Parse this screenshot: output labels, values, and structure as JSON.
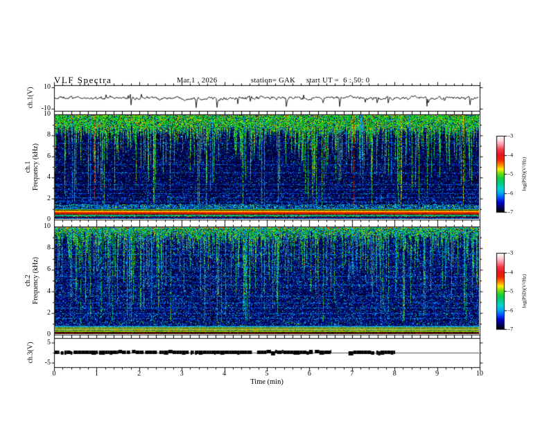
{
  "header": {
    "title": "VLF Spectra",
    "date": "Mar.1 , 2026",
    "station": "station= GAK",
    "start_ut": "start UT =  6 : 50: 0"
  },
  "axes": {
    "time": {
      "label": "Time (min)",
      "tick_labels": [
        "0",
        "1",
        "2",
        "3",
        "4",
        "5",
        "6",
        "7",
        "8",
        "9",
        "10"
      ],
      "minor_tick_step_min": 0.2
    },
    "ch1_wave": {
      "ylabel": "ch.1(V)",
      "tick_labels": [
        "10",
        "-10"
      ]
    },
    "ch1_spec": {
      "ylabel_ch": "ch.1",
      "ylabel_freq": "Frequency (kHz)",
      "tick_labels": [
        "10",
        "8",
        "6",
        "4",
        "2",
        "0"
      ]
    },
    "ch2_spec": {
      "ylabel_ch": "ch.2",
      "ylabel_freq": "Frequency (kHz)",
      "tick_labels": [
        "10",
        "8",
        "6",
        "4",
        "2",
        "0"
      ]
    },
    "ch3": {
      "ylabel": "ch.3(V)",
      "tick_labels": [
        "5",
        "-5"
      ]
    }
  },
  "colorbar": {
    "label": "log(PSD)(V²/Hz)",
    "tick_labels": [
      "-3",
      "-4",
      "-5",
      "-6",
      "-7"
    ],
    "gradient_top_to_bottom": [
      "#ffffff",
      "#ffd5dd",
      "#ff8899",
      "#f23344",
      "#e81822",
      "#ee2200",
      "#ff7700",
      "#ffee00",
      "#66dd11",
      "#11cc44",
      "#00cc88",
      "#00d5cc",
      "#00aaee",
      "#0055ff",
      "#0000cc",
      "#000066",
      "#000000"
    ]
  },
  "colors": {
    "frame": "#000000",
    "waveform": "#000000",
    "ch3_thin_line": "#555555",
    "ch3_band": "#000000"
  },
  "chart_data": {
    "type": "composite",
    "x_axis": {
      "label": "Time (min)",
      "range": [
        0,
        10
      ],
      "major_tick_step": 1,
      "minor_tick_step": 0.2
    },
    "panels": [
      {
        "id": "ch1_waveform",
        "type": "line",
        "ylabel": "ch.1(V)",
        "yticks": [
          10,
          -10
        ],
        "description": "Continuous black noisy voltage trace centred on 0 V, fluctuations about ±2 V, with occasional sharp negative spikes reaching about -8 V spread across the full 10 minutes."
      },
      {
        "id": "ch1_spectrogram",
        "type": "heatmap",
        "ylabel": "ch.1 Frequency (kHz)",
        "yrange_khz": [
          0,
          10
        ],
        "yticks": [
          10,
          8,
          6,
          4,
          2,
          0
        ],
        "value_label": "log(PSD)(V²/Hz)",
        "value_range": [
          -7,
          -3
        ],
        "features": [
          "dense green-yellow speckle above ~8 kHz across all times",
          "many narrow green/cyan vertical streaks descending from the top band to 3-7 kHz",
          "dark blue / black background from ~1.2 to 7 kHz with sparse blue speckle",
          "faint horizontal blue lines near 1.4-5.3 kHz",
          "bright continuous orange-red horizontal band ~0.5-0.9 kHz with a yellow line at its top edge",
          "green/cyan and purple speckle rows below 0.5 kHz",
          "sparse thin yellow/red full-height vertical lines"
        ]
      },
      {
        "id": "ch2_spectrogram",
        "type": "heatmap",
        "ylabel": "ch.2 Frequency (kHz)",
        "yrange_khz": [
          0,
          10
        ],
        "yticks": [
          10,
          8,
          6,
          4,
          2,
          0
        ],
        "value_label": "log(PSD)(V²/Hz)",
        "value_range": [
          -7,
          -3
        ],
        "features": [
          "overall bluer than ch.1 with dense blue/cyan vertical streaks of varying depth",
          "green speckle near 9-10 kHz and multicolour speckle row at the very top edge",
          "dark red vertical lines near t≈2.4 min and t≈6.2 min",
          "horizontal cyan/blue lines near 1-6.3 kHz",
          "yellow-green horizontal lines below ~1 kHz",
          "dark red line along the bottom edge"
        ]
      },
      {
        "id": "ch3_status",
        "type": "line",
        "ylabel": "ch.3(V)",
        "yticks": [
          5,
          -5
        ],
        "segments": [
          {
            "t_start_min": 0.0,
            "t_end_min": 6.5,
            "level_V": 0,
            "style": "thick noisy black band"
          },
          {
            "t_start_min": 6.5,
            "t_end_min": 6.85,
            "level_V": 0,
            "style": "thin line"
          },
          {
            "t_start_min": 6.85,
            "t_end_min": 8.0,
            "level_V": 0,
            "style": "thick noisy black band"
          },
          {
            "t_start_min": 8.0,
            "t_end_min": 10.0,
            "level_V": 0,
            "style": "thin line"
          }
        ]
      }
    ]
  }
}
